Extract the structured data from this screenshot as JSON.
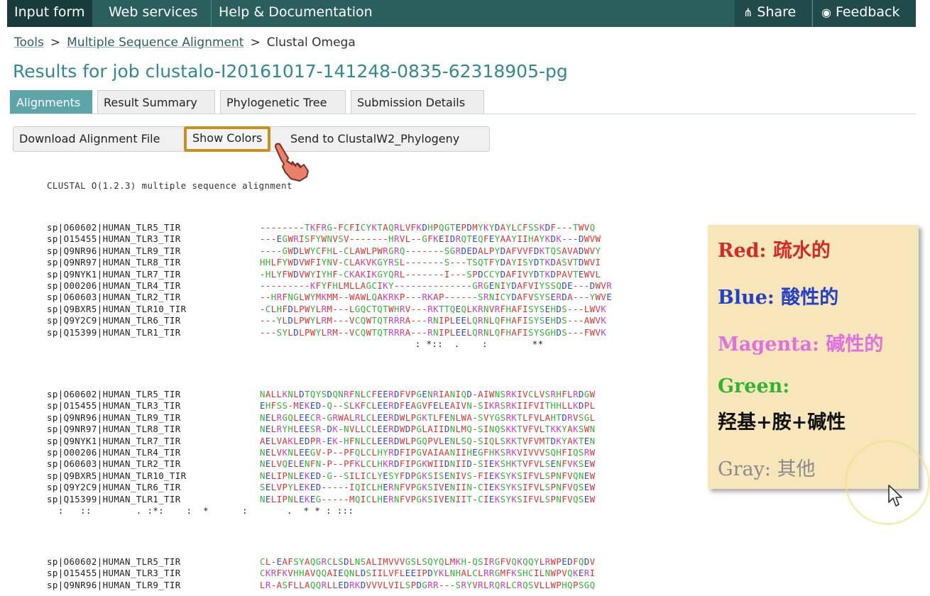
{
  "nav": {
    "items": [
      "Input form",
      "Web services",
      "Help & Documentation"
    ],
    "share": "Share",
    "feedback": "Feedback"
  },
  "breadcrumb": {
    "tools": "Tools",
    "sep1": ">",
    "msa": "Multiple Sequence Alignment",
    "sep2": ">",
    "current": "Clustal Omega"
  },
  "job_title": "Results for job clustalo-I20161017-141248-0835-62318905-pg",
  "tabs": [
    "Alignments",
    "Result Summary",
    "Phylogenetic Tree",
    "Submission Details"
  ],
  "buttons": {
    "download": "Download Alignment File",
    "show_colors": "Show Colors",
    "send": "Send to ClustalW2_Phylogeny"
  },
  "alignment": {
    "header": "CLUSTAL O(1.2.3) multiple sequence alignment",
    "names": [
      "sp|O60602|HUMAN_TLR5_TIR",
      "sp|O15455|HUMAN_TLR3_TIR",
      "sp|Q9NR96|HUMAN_TLR9_TIR",
      "sp|Q9NR97|HUMAN_TLR8_TIR",
      "sp|Q9NYK1|HUMAN_TLR7_TIR",
      "sp|O00206|HUMAN_TLR4_TIR",
      "sp|O60603|HUMAN_TLR2_TIR",
      "sp|Q9BXR5|HUMAN_TLR10_TIR",
      "sp|Q9Y2C9|HUMAN_TLR6_TIR",
      "sp|Q15399|HUMAN_TLR1_TIR"
    ],
    "blocks": [
      {
        "seqs": [
          "--------TKFRG-FCFICYKTAQRLVFKDHPQGTEPDMYKYDAYLCFSSKDF---TWVQ",
          "---EGWRISFYWNVSV-------HRVL--GFKEIDRQTEQFEYAAYIIHAYKDK---DWVW",
          "----GWDLWYCFHL-CLAWLPWRGRQ-------SGRDEDALPYDAFVVFDKTQSAVADWVY",
          "HHLFYWDVWFIYNV-CLAKVKGYRSL-------S---TSQTFYDAYISYDTKDASVTDWVI",
          "-HLYFWDVWYIYHF-CKAKIKGYQRL-------I---SPDCCYDAFIVYDTKDPAVTEWVL",
          "---------KFYFHLMLLAGCIKY--------------GRGENIYDAFVIYSSQDE---DWVR",
          "--HRFNGLWYMKMM--WAWLQAKRKP---RKAP------SRNICYDAFVSYSERDA---YWVE",
          "-CLHFDLPWYLRM---LGQCTQTWHRV---RKTTQEQLKRNVRFHAFISYSEHDS---LWVK",
          "---YLDLPWYLRM---VCQWTQTRRRA---RNIPLEELQRNLQFHAFISYSEHDS---AWVK",
          "---SYLDLPWYLRM--VCQWTQTRRRA---RNIPLEELQRNLQFHAFISYSGHDS---FWVK"
        ],
        "conservation": "                                                                  : *::  .    :        **"
      },
      {
        "seqs": [
          "NALLKNLDTQYSDQNRFNLCFEERDFVPGENRIANIQD-AIWNSRKIVCLVSRHFLRDGW",
          "EHFSS-MEKED-Q--SLKFCLEERDFEAGVFELEAIVN-SIKRSRKIIFVITHHLLKDPL",
          "NELRGQLEECR-GRWALRLCLEERDWLPGKTLFENLWA-SVYGSRKTLFVLAHTDRVSGL",
          "NELRYHLEESR-DK-NVLLCLEERDWDPGLAIIDNLMQ-SINQSKKTVFVLTKKYAKSWN",
          "AELVAKLEDPR-EK-HFNLCLEERDWLPGQPVLENLSQ-SIQLSKKTVFVMTDKYAKTEN",
          "NELVKNLEEGV-P--PFQLCLHYRDFIPGVAIAANIIHEGFHKSRKVIVVVSQHFIQSRW",
          "NELVQELENFN-P--PFKLCLHKRDFIPGKWIIDNIID-SIEKSHKTVFVLSENFVKSEW",
          "NELIPNLEKED-G--SILICLYESYFDPGKSISENIVS-FIEKSYKSIFVLSPNFVQNEW",
          "SELVPYLEKED-----IQICLHERNFVPGKSIVENIIN-CIEKSYKSIFVLSPNFVQSEW",
          "NELIPNLEKEG-----MQICLHERNFVPGKSIVENIIT-CIEKSYKSIFVLSPNFVQSEW"
        ],
        "conservation": "  :   ::        . :*:    :  *      :       .  * * : :::"
      },
      {
        "seqs": [
          "CL-EAFSYAQGRCLSDLNSALIMVVVGSLSQYQLMKH-QSIRGFVQKQQYLRWPEDFQDV",
          "CKRFKVHHAVQQAIEQNLDSIILVFLEEIPDYKLNHALCLRRGMFKSHCILNWPVQKERI",
          "LR-ASFLLAQQRLLEDRKDVVVLVILSPDGRR---SRYVRLRQRLCRQSVLLWPHQPSGQ"
        ]
      }
    ]
  },
  "legend": {
    "red": "Red: 疏水的",
    "blue": "Blue: 酸性的",
    "magenta": "Magenta: 碱性的",
    "green": "Green:",
    "green2": "羟基+胺+碱性",
    "gray": "Gray: 其他"
  },
  "colors": {
    "nav_bg": "#2b5f5e",
    "active_tab": "#5ea5a9",
    "title": "#2f8a93",
    "highlight_border": "#c8911f",
    "res_red": "#e3312b",
    "res_blue": "#2b48d9",
    "res_magenta": "#d23cd2",
    "res_green": "#2fb52f",
    "res_gray": "#888888",
    "legend_bg": "#f6e6ba"
  }
}
